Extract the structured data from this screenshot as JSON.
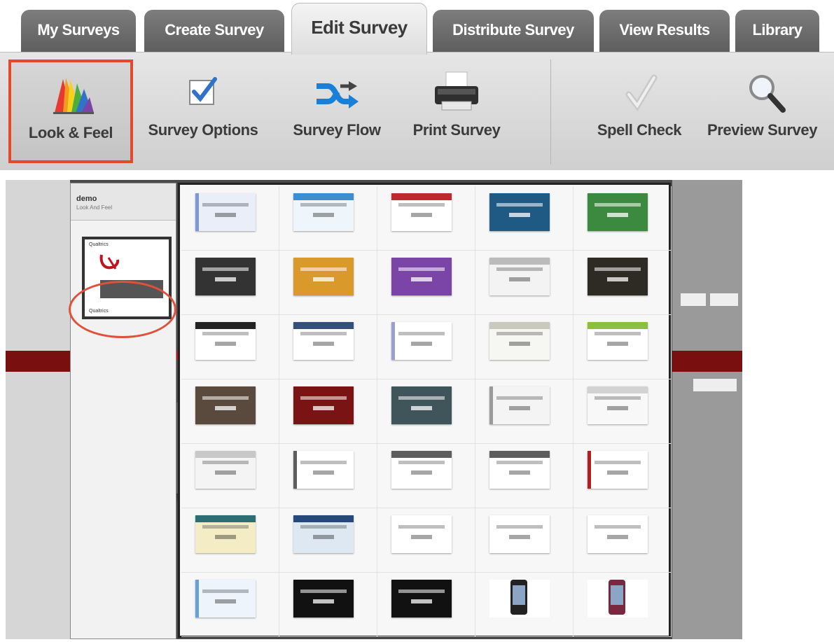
{
  "tabs": [
    {
      "label": "My Surveys",
      "active": false
    },
    {
      "label": "Create Survey",
      "active": false
    },
    {
      "label": "Edit Survey",
      "active": true
    },
    {
      "label": "Distribute Survey",
      "active": false
    },
    {
      "label": "View Results",
      "active": false
    },
    {
      "label": "Library",
      "active": false
    }
  ],
  "toolbar": {
    "look_feel": "Look & Feel",
    "survey_options": "Survey Options",
    "survey_flow": "Survey Flow",
    "print_survey": "Print Survey",
    "spell_check": "Spell Check",
    "preview_survey": "Preview Survey"
  },
  "colors": {
    "highlight": "#e14a2d",
    "tab_inactive": "#6b6b6b",
    "tab_active": "#e9e9e9",
    "checkbox_blue": "#2f72c9",
    "flow_blue": "#1a7fd6"
  },
  "panel": {
    "title": "demo",
    "subtitle": "Look And Feel",
    "selected_theme_top": "Qualtrics",
    "selected_theme_bottom": "Qualtrics"
  },
  "themes": [
    {
      "style": "light",
      "color": "#e9eef9",
      "accent": "#7d98d8"
    },
    {
      "style": "light",
      "color": "#eef6fb",
      "accent": "#3b8fd0"
    },
    {
      "style": "light",
      "color": "#ffffff",
      "accent": "#c0282e"
    },
    {
      "style": "dark",
      "color": "#1f5a85",
      "accent": "#1f5a85"
    },
    {
      "style": "dark",
      "color": "#3c8a3f",
      "accent": "#3c8a3f"
    },
    {
      "style": "dark",
      "color": "#333333",
      "accent": "#333333"
    },
    {
      "style": "dark",
      "color": "#d99a2b",
      "accent": "#d99a2b"
    },
    {
      "style": "dark",
      "color": "#7b45a8",
      "accent": "#7b45a8"
    },
    {
      "style": "light",
      "color": "#f3f3f3",
      "accent": "#bbbbbb"
    },
    {
      "style": "dark",
      "color": "#2e2a24",
      "accent": "#2e2a24"
    },
    {
      "style": "light",
      "color": "#ffffff",
      "accent": "#222222"
    },
    {
      "style": "light",
      "color": "#ffffff",
      "accent": "#334f7a"
    },
    {
      "style": "light",
      "color": "#ffffff",
      "accent": "#9aa0d0"
    },
    {
      "style": "light",
      "color": "#f6f6f2",
      "accent": "#c9c9bd"
    },
    {
      "style": "light",
      "color": "#ffffff",
      "accent": "#8cbf3e"
    },
    {
      "style": "dark",
      "color": "#5a4a3d",
      "accent": "#5a4a3d"
    },
    {
      "style": "dark",
      "color": "#7a1414",
      "accent": "#7a1414"
    },
    {
      "style": "dark",
      "color": "#3f555a",
      "accent": "#3f555a"
    },
    {
      "style": "light",
      "color": "#f4f4f4",
      "accent": "#9a9a9a"
    },
    {
      "style": "light",
      "color": "#f8f8f8",
      "accent": "#d2d2d2"
    },
    {
      "style": "light",
      "color": "#f4f4f4",
      "accent": "#c8c8c8"
    },
    {
      "style": "light",
      "color": "#ffffff",
      "accent": "#5d5d5d"
    },
    {
      "style": "light",
      "color": "#ffffff",
      "accent": "#5d5d5d"
    },
    {
      "style": "light",
      "color": "#ffffff",
      "accent": "#5d5d5d"
    },
    {
      "style": "light",
      "color": "#ffffff",
      "accent": "#b51e1e"
    },
    {
      "style": "light",
      "color": "#f4ecc4",
      "accent": "#2c6e73"
    },
    {
      "style": "light",
      "color": "#dde8f2",
      "accent": "#27497a"
    },
    {
      "style": "light",
      "color": "#ffffff",
      "accent": "#ffffff"
    },
    {
      "style": "light",
      "color": "#ffffff",
      "accent": "#ffffff"
    },
    {
      "style": "light",
      "color": "#ffffff",
      "accent": "#ffffff"
    },
    {
      "style": "light",
      "color": "#eef4fb",
      "accent": "#6aa0d8"
    },
    {
      "style": "dark",
      "color": "#111111",
      "accent": "#111111"
    },
    {
      "style": "dark",
      "color": "#111111",
      "accent": "#111111"
    },
    {
      "style": "phone",
      "color": "#ffffff",
      "accent": "#222222"
    },
    {
      "style": "phone",
      "color": "#ffffff",
      "accent": "#7a2740"
    }
  ]
}
